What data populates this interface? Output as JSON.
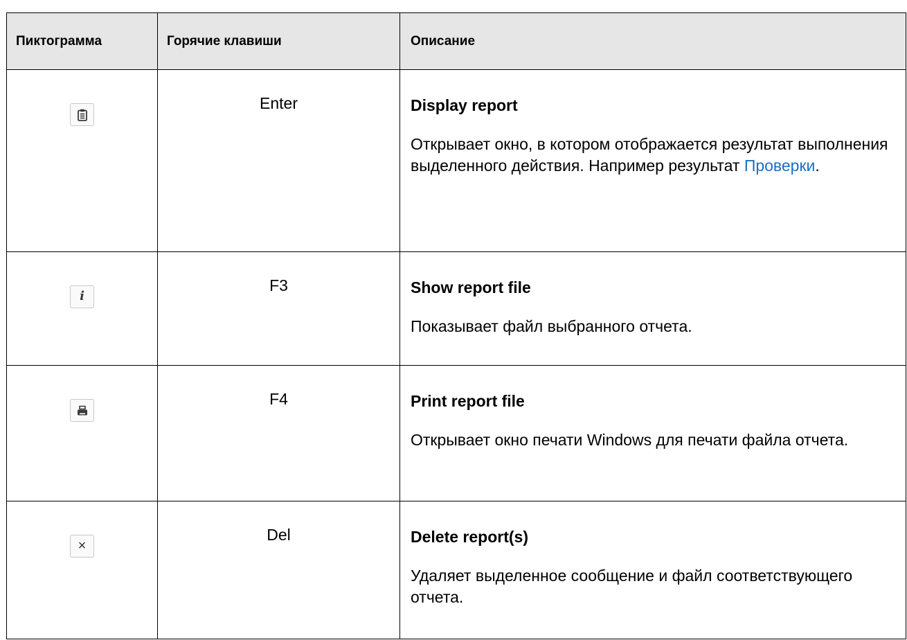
{
  "table": {
    "headers": {
      "icon": "Пиктограмма",
      "hotkeys": "Горячие клавиши",
      "description": "Описание"
    },
    "rows": [
      {
        "icon": "clipboard-report-icon",
        "key": "Enter",
        "title": "Display report",
        "text_before_link": "Открывает окно, в котором отображается результат выполнения выделенного действия. Например результат ",
        "link": "Проверки",
        "text_after_link": "."
      },
      {
        "icon": "info-icon",
        "key": "F3",
        "title": "Show report file",
        "text": "Показывает файл выбранного отчета."
      },
      {
        "icon": "printer-icon",
        "key": "F4",
        "title": "Print report file",
        "text": "Открывает окно печати Windows для печати файла отчета."
      },
      {
        "icon": "close-icon",
        "key": "Del",
        "title": "Delete report(s)",
        "text": "Удаляет выделенное сообщение и файл соответствующего отчета."
      }
    ]
  },
  "colors": {
    "header_bg": "#e6e6e6",
    "border": "#000000",
    "link": "#1a6fc4"
  }
}
